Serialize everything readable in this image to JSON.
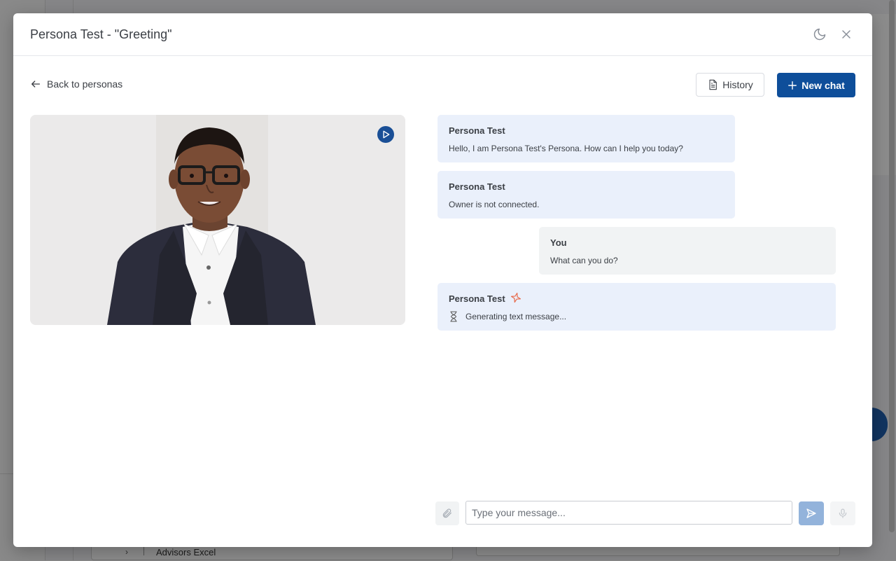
{
  "background": {
    "row_text": "Advisors Excel"
  },
  "modal": {
    "title": "Persona Test - \"Greeting\"",
    "back_label": "Back to personas",
    "history_label": "History",
    "new_chat_label": "New chat"
  },
  "icons": {
    "theme": "moon-icon",
    "close": "close-icon",
    "back": "arrow-left-icon",
    "history": "document-icon",
    "new_chat": "plus-icon",
    "play": "play-icon",
    "sparkle": "sparkle-icon",
    "hourglass": "hourglass-icon",
    "attach": "paperclip-icon",
    "send": "send-icon",
    "mic": "microphone-icon"
  },
  "colors": {
    "primary": "#0e4e9a",
    "persona_bubble": "#eaf0fb",
    "user_bubble": "#f1f3f4",
    "sparkle": "#e8694a"
  },
  "messages": [
    {
      "sender": "Persona Test",
      "text": "Hello, I am Persona Test's Persona. How can I help you today?"
    },
    {
      "sender": "Persona Test",
      "text": "Owner is not connected."
    },
    {
      "sender": "You",
      "text": "What can you do?"
    },
    {
      "sender": "Persona Test",
      "text": "Generating text message..."
    }
  ],
  "composer": {
    "placeholder": "Type your message...",
    "value": ""
  }
}
